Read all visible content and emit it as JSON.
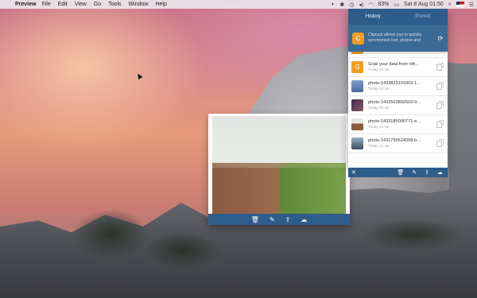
{
  "menubar": {
    "app_name": "Preview",
    "menus": [
      "File",
      "Edit",
      "View",
      "Go",
      "Tools",
      "Window",
      "Help"
    ],
    "battery": "83%",
    "datetime": "Sat 8 Aug  01:50"
  },
  "preview_window": {
    "toolbar_icons": [
      "trash-icon",
      "pin-icon",
      "share-icon",
      "cloud-upload-icon"
    ]
  },
  "clipcast": {
    "tabs": [
      {
        "label": "History",
        "active": true
      },
      {
        "label": "Pinned",
        "active": false
      }
    ],
    "banner": {
      "badge": "C",
      "text": "Clipcast allows you to quickly synchronize text, photos and"
    },
    "items": [
      {
        "thumb": "C",
        "thumb_color": "#f39c21",
        "title": "",
        "time": "Today 01:18"
      },
      {
        "thumb": "G",
        "thumb_color": "#f39c21",
        "title": "Grab your data from oth...",
        "time": "Today 01:18"
      },
      {
        "thumb": "",
        "thumb_color": "#5f7fb0",
        "title": "photo-1433833103303-1...",
        "time": "Today 01:18"
      },
      {
        "thumb": "",
        "thumb_color": "#6a4a7a",
        "title": "photo-1432563892503-9...",
        "time": "Today 01:18"
      },
      {
        "thumb": "",
        "thumb_color": "#8b6a55",
        "title": "photo-1433185000771-e...",
        "time": "Today 01:18"
      },
      {
        "thumb": "",
        "thumb_color": "#7c8fa6",
        "title": "photo-1431730524508-b...",
        "time": "Today 01:18"
      }
    ]
  },
  "colors": {
    "accent": "#2e5d8c",
    "badge": "#f39c21"
  }
}
